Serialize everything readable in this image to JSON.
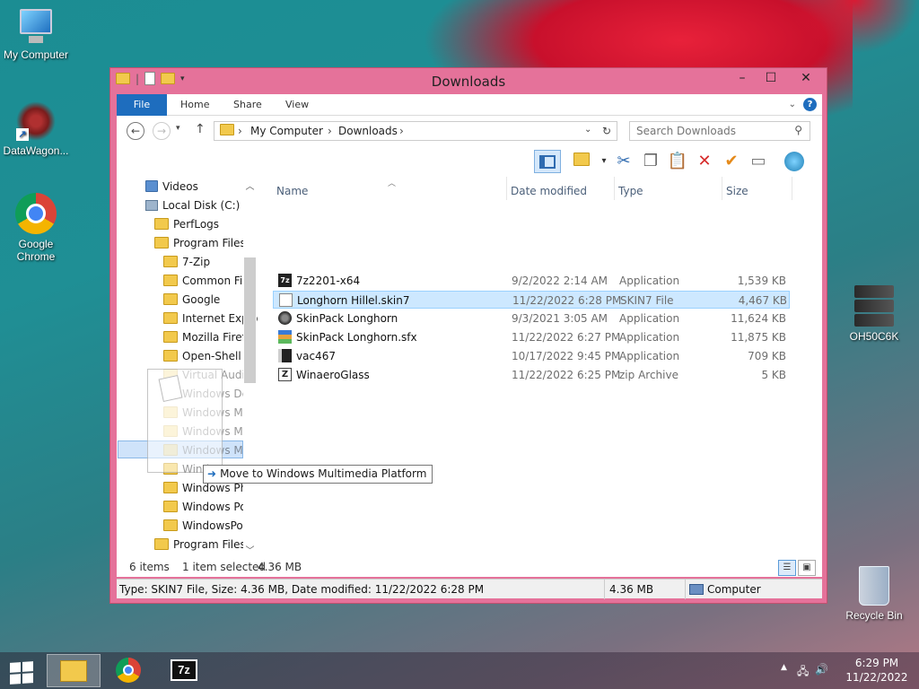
{
  "desktop": {
    "icons": [
      {
        "label": "My Computer"
      },
      {
        "label": "DataWagon..."
      },
      {
        "label": "Google Chrome"
      },
      {
        "label": "OH50C6K"
      },
      {
        "label": "Recycle Bin"
      }
    ]
  },
  "window": {
    "title": "Downloads",
    "controls": {
      "minimize": "–",
      "maximize": "☐",
      "close": "✕"
    },
    "ribbon_tabs": [
      "File",
      "Home",
      "Share",
      "View"
    ],
    "address": {
      "segments": [
        "My Computer",
        "Downloads"
      ]
    },
    "search": {
      "placeholder": "Search Downloads"
    }
  },
  "nav_tree": [
    {
      "label": "Videos"
    },
    {
      "label": "Local Disk (C:)"
    },
    {
      "label": "PerfLogs"
    },
    {
      "label": "Program Files"
    },
    {
      "label": "7-Zip"
    },
    {
      "label": "Common File"
    },
    {
      "label": "Google"
    },
    {
      "label": "Internet Explo"
    },
    {
      "label": "Mozilla Firefc"
    },
    {
      "label": "Open-Shell"
    },
    {
      "label": "Virtual Audio"
    },
    {
      "label": "Windows Def"
    },
    {
      "label": "Windows Ma"
    },
    {
      "label": "Windows Me"
    },
    {
      "label": "Windows Mu"
    },
    {
      "label": "Windo"
    },
    {
      "label": "Windows Pho"
    },
    {
      "label": "Windows Por"
    },
    {
      "label": "WindowsPow"
    },
    {
      "label": "Program Files ("
    }
  ],
  "columns": {
    "name": "Name",
    "date": "Date modified",
    "type": "Type",
    "size": "Size"
  },
  "files": [
    {
      "name": "7z2201-x64",
      "date": "9/2/2022 2:14 AM",
      "type": "Application",
      "size": "1,539 KB",
      "icon": "7z-icon"
    },
    {
      "name": "Longhorn Hillel.skin7",
      "date": "11/22/2022 6:28 PM",
      "type": "SKIN7 File",
      "size": "4,467 KB",
      "icon": "document-icon"
    },
    {
      "name": "SkinPack Longhorn",
      "date": "9/3/2021 3:05 AM",
      "type": "Application",
      "size": "11,624 KB",
      "icon": "app-icon"
    },
    {
      "name": "SkinPack Longhorn.sfx",
      "date": "11/22/2022 6:27 PM",
      "type": "Application",
      "size": "11,875 KB",
      "icon": "sfx-icon"
    },
    {
      "name": "vac467",
      "date": "10/17/2022 9:45 PM",
      "type": "Application",
      "size": "709 KB",
      "icon": "vac-icon"
    },
    {
      "name": "WinaeroGlass",
      "date": "11/22/2022 6:25 PM",
      "type": "zip Archive",
      "size": "5 KB",
      "icon": "zip-icon"
    }
  ],
  "status": {
    "count": "6 items",
    "selected": "1 item selected",
    "selected_size": "4.36 MB"
  },
  "details_bar": {
    "info": "Type: SKIN7 File, Size: 4.36 MB, Date modified: 11/22/2022 6:28 PM",
    "size": "4.36 MB",
    "location": "Computer"
  },
  "drag_tooltip": "Move to Windows Multimedia Platform",
  "taskbar": {
    "time": "6:29 PM",
    "date": "11/22/2022"
  }
}
